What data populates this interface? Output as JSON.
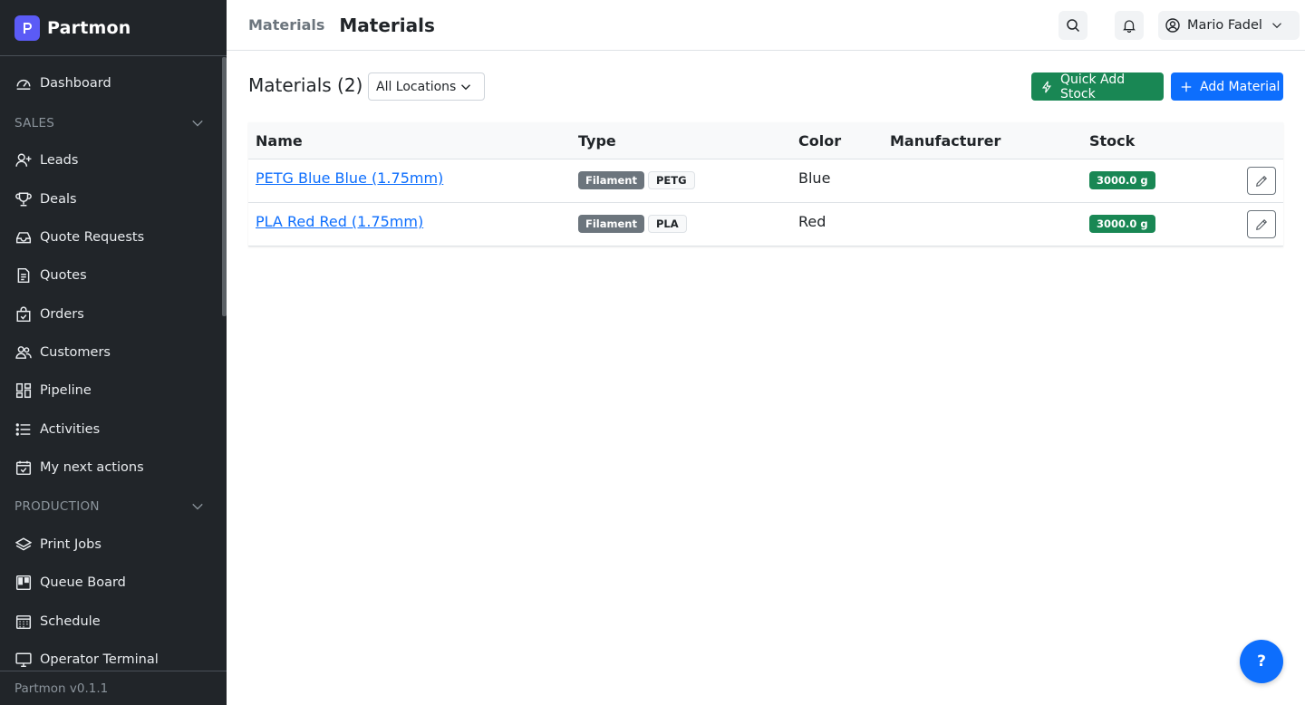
{
  "app": {
    "name": "Partmon",
    "version": "Partmon v0.1.1"
  },
  "sidebar": {
    "dashboard": "Dashboard",
    "sales_section": "SALES",
    "sales_items": [
      {
        "label": "Leads",
        "icon": "user-plus-icon"
      },
      {
        "label": "Deals",
        "icon": "trophy-icon"
      },
      {
        "label": "Quote Requests",
        "icon": "inbox-icon"
      },
      {
        "label": "Quotes",
        "icon": "file-text-icon"
      },
      {
        "label": "Orders",
        "icon": "bag-check-icon"
      },
      {
        "label": "Customers",
        "icon": "people-icon"
      },
      {
        "label": "Pipeline",
        "icon": "kanban-icon"
      },
      {
        "label": "Activities",
        "icon": "list-icon"
      },
      {
        "label": "My next actions",
        "icon": "calendar-check-icon"
      }
    ],
    "production_section": "PRODUCTION",
    "production_items": [
      {
        "label": "Print Jobs",
        "icon": "layers-icon"
      },
      {
        "label": "Queue Board",
        "icon": "board-icon"
      },
      {
        "label": "Schedule",
        "icon": "calendar-grid-icon"
      },
      {
        "label": "Operator Terminal",
        "icon": "monitor-icon"
      }
    ]
  },
  "header": {
    "breadcrumb": "Materials",
    "title": "Materials",
    "user_name": "Mario Fadel"
  },
  "toolbar": {
    "title": "Materials (2)",
    "location_filter": "All Locations",
    "quick_add_label": "Quick Add Stock",
    "add_material_label": "Add Material"
  },
  "table": {
    "columns": [
      "Name",
      "Type",
      "Color",
      "Manufacturer",
      "Stock"
    ],
    "rows": [
      {
        "name": "PETG Blue Blue (1.75mm)",
        "type": "Filament",
        "material": "PETG",
        "color": "Blue",
        "manufacturer": "",
        "stock": "3000.0 g"
      },
      {
        "name": "PLA Red Red (1.75mm)",
        "type": "Filament",
        "material": "PLA",
        "color": "Red",
        "manufacturer": "",
        "stock": "3000.0 g"
      }
    ]
  },
  "help_label": "?",
  "colors": {
    "sidebar_bg": "#212529",
    "brand": "#5b5bf6",
    "primary": "#0d6efd",
    "success": "#198754",
    "secondary": "#6c757d"
  }
}
